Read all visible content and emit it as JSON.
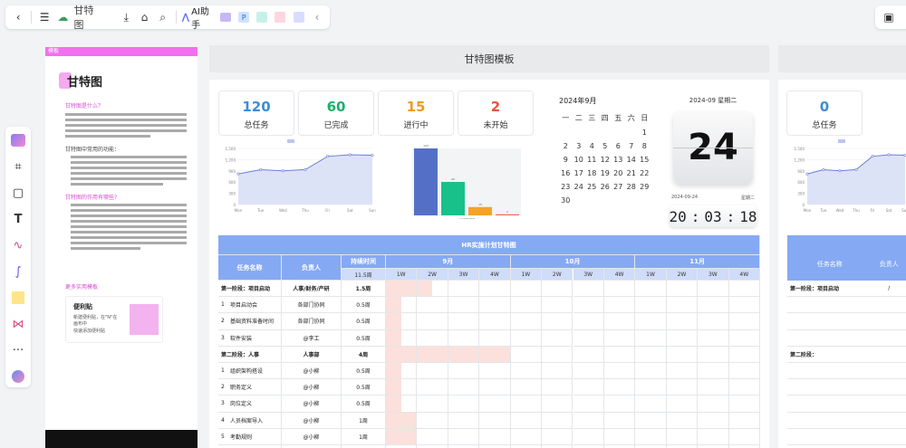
{
  "toolbar": {
    "doc_title": "甘特图",
    "ai_label": "AI助手"
  },
  "doc": {
    "tag": "模板",
    "title": "甘特图",
    "section1": "甘特图是什么？",
    "section2": "甘特图的作用有哪些?",
    "section3": "甘特图中常用的功能：",
    "section4": "甘特图的什么场景？",
    "more": "更多实用模板",
    "card_title": "便利贴",
    "card_body1": "新建便利贴，在\"N\"在画布中",
    "card_body2": "快速添加便利贴"
  },
  "board1": {
    "title": "甘特图模板",
    "stats": [
      {
        "value": "120",
        "label": "总任务",
        "color": "#3b8ed6"
      },
      {
        "value": "60",
        "label": "已完成",
        "color": "#19b26a"
      },
      {
        "value": "15",
        "label": "进行中",
        "color": "#f09a1d"
      },
      {
        "value": "2",
        "label": "未开始",
        "color": "#e6543e"
      }
    ],
    "calendar": {
      "month": "2024年9月",
      "weekdays": [
        "一",
        "二",
        "三",
        "四",
        "五",
        "六",
        "日"
      ],
      "days": [
        "",
        "",
        "",
        "",
        "",
        "",
        "1",
        "2",
        "3",
        "4",
        "5",
        "6",
        "7",
        "8",
        "9",
        "10",
        "11",
        "12",
        "13",
        "14",
        "15",
        "16",
        "17",
        "18",
        "19",
        "20",
        "21",
        "22",
        "23",
        "24",
        "25",
        "26",
        "27",
        "28",
        "29",
        "30"
      ]
    },
    "clock": {
      "date": "2024-09 星期二",
      "day": "24",
      "small_date": "2024-09-24",
      "small_label": "星期二",
      "hh": "20",
      "mm": "03",
      "ss": "18"
    }
  },
  "gantt": {
    "title": "HR实施计划甘特图",
    "col_task": "任务名称",
    "col_owner": "负责人",
    "col_dur": "持续时间",
    "dur_unit": "11.5周",
    "months": [
      "9月",
      "10月",
      "11月"
    ],
    "weeks": [
      "1W",
      "2W",
      "3W",
      "4W",
      "1W",
      "2W",
      "3W",
      "4W",
      "1W",
      "2W",
      "3W",
      "4W"
    ],
    "rows": [
      {
        "no": "",
        "task": "第一阶段：项目启动",
        "owner": "人事/财务/产研",
        "dur": "1.5周",
        "bold": true,
        "start": 0,
        "len": 1.5
      },
      {
        "no": "1",
        "task": "项目启动会",
        "owner": "各部门协同",
        "dur": "0.5周",
        "bold": false,
        "start": 0,
        "len": 0.5
      },
      {
        "no": "2",
        "task": "基础资料准备时间",
        "owner": "各部门协同",
        "dur": "0.5周",
        "bold": false,
        "start": 0,
        "len": 0.5
      },
      {
        "no": "3",
        "task": "软件安装",
        "owner": "@李工",
        "dur": "0.5周",
        "bold": false,
        "start": 0,
        "len": 0.5
      },
      {
        "no": "",
        "task": "第二阶段：人事",
        "owner": "人事部",
        "dur": "4周",
        "bold": true,
        "start": 0,
        "len": 4
      },
      {
        "no": "1",
        "task": "组织架构搭设",
        "owner": "@小柳",
        "dur": "0.5周",
        "bold": false,
        "start": 0,
        "len": 0.5
      },
      {
        "no": "2",
        "task": "职务定义",
        "owner": "@小柳",
        "dur": "0.5周",
        "bold": false,
        "start": 0,
        "len": 0.5
      },
      {
        "no": "3",
        "task": "岗位定义",
        "owner": "@小柳",
        "dur": "0.5周",
        "bold": false,
        "start": 0,
        "len": 0.5
      },
      {
        "no": "4",
        "task": "人员档案导入",
        "owner": "@小柳",
        "dur": "1周",
        "bold": false,
        "start": 0,
        "len": 1
      },
      {
        "no": "5",
        "task": "考勤规则",
        "owner": "@小柳",
        "dur": "1周",
        "bold": false,
        "start": 0,
        "len": 1
      },
      {
        "no": "6",
        "task": "",
        "owner": "",
        "dur": "",
        "bold": false,
        "start": 0,
        "len": 0
      }
    ]
  },
  "board2": {
    "stat_value": "0",
    "stat_label": "总任务",
    "col_task": "任务名称",
    "col_owner": "负责人",
    "row1": "第一阶段：项目启动",
    "row1_owner": "/",
    "row2": "第二阶段："
  },
  "chart_data": [
    {
      "type": "area",
      "categories": [
        "Mon",
        "Tue",
        "Wed",
        "Thu",
        "Fri",
        "Sat",
        "Sun"
      ],
      "series": [
        {
          "values": [
            820,
            932,
            901,
            934,
            1290,
            1330,
            1320
          ]
        }
      ],
      "ylim": [
        0,
        1500
      ],
      "yticks": [
        "0",
        "300",
        "600",
        "900",
        "1,200",
        "1,500"
      ]
    },
    {
      "type": "bar",
      "categories": [
        "总任务",
        "已完成",
        "进行中",
        "未开始"
      ],
      "values": [
        120,
        60,
        15,
        2
      ],
      "colors": [
        "#5470c6",
        "#19c18a",
        "#f5a325",
        "#ee6b5a"
      ],
      "xlabel": "HR实施进度"
    }
  ]
}
